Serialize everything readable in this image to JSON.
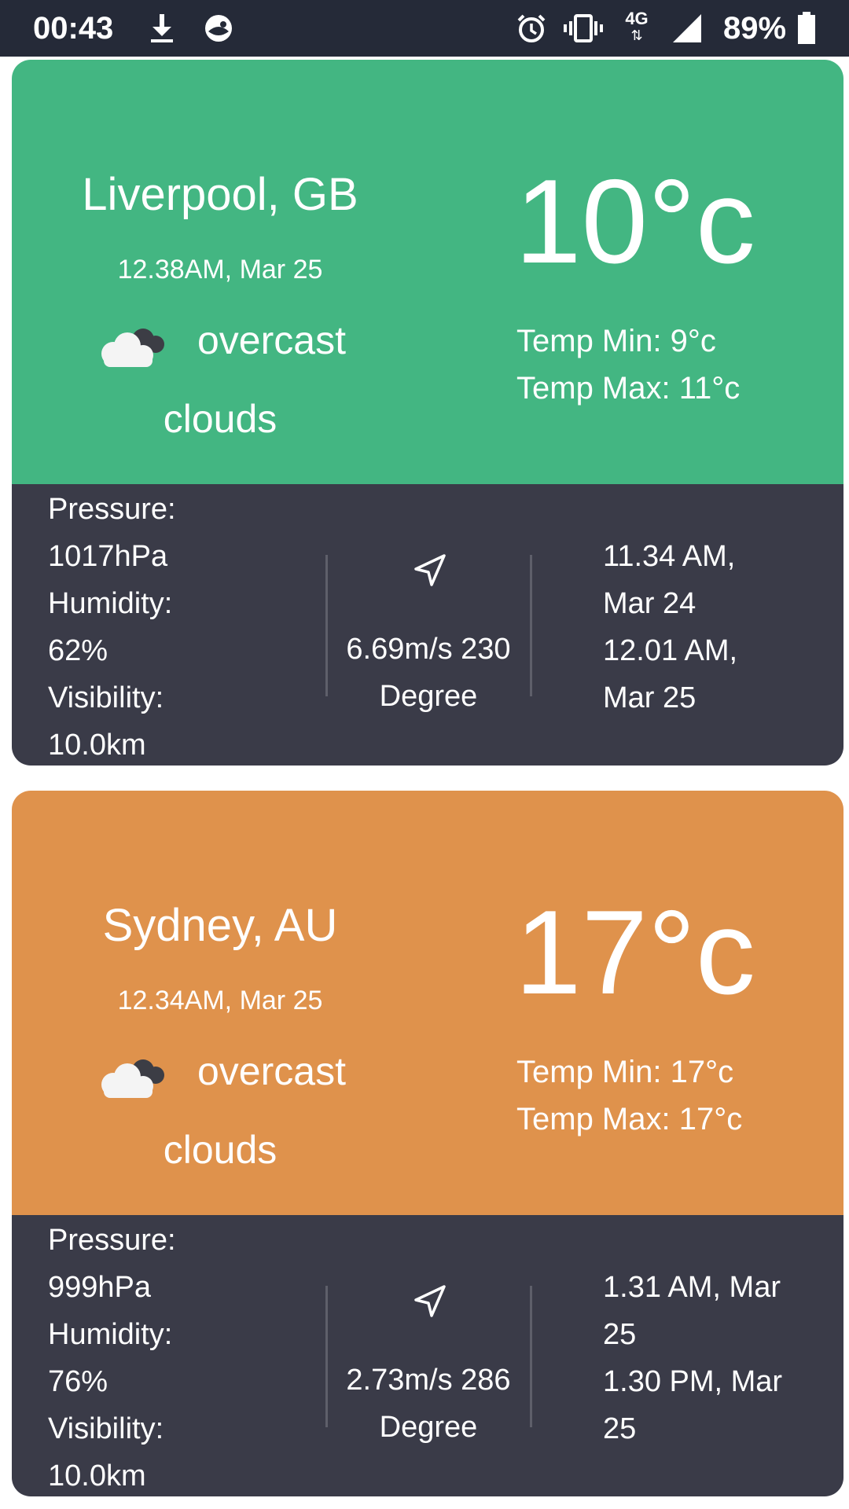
{
  "status_bar": {
    "time": "00:43",
    "battery": "89%",
    "network": "4G"
  },
  "cards": [
    {
      "city": "Liverpool, GB",
      "local_time": "12.38AM, Mar 25",
      "description_line1": "overcast",
      "description_line2": "clouds",
      "temp": "10°c",
      "temp_min": "Temp Min: 9°c",
      "temp_max": "Temp Max: 11°c",
      "pressure_label": "Pressure:",
      "pressure_value": "1017hPa",
      "humidity_label": "Humidity:",
      "humidity_value": "62%",
      "visibility_label": "Visibility:",
      "visibility_value": "10.0km",
      "wind_line1": "6.69m/s 230",
      "wind_line2": "Degree",
      "sunrise_line1": "11.34 AM,",
      "sunrise_line2": "Mar 24",
      "sunset_line1": "12.01 AM,",
      "sunset_line2": "Mar 25",
      "color": "#43b682"
    },
    {
      "city": "Sydney, AU",
      "local_time": "12.34AM, Mar 25",
      "description_line1": "overcast",
      "description_line2": "clouds",
      "temp": "17°c",
      "temp_min": "Temp Min: 17°c",
      "temp_max": "Temp Max: 17°c",
      "pressure_label": "Pressure:",
      "pressure_value": "999hPa",
      "humidity_label": "Humidity:",
      "humidity_value": "76%",
      "visibility_label": "Visibility:",
      "visibility_value": "10.0km",
      "wind_line1": "2.73m/s 286",
      "wind_line2": "Degree",
      "sunrise_line1": "1.31 AM, Mar",
      "sunrise_line2": "25",
      "sunset_line1": "1.30 PM, Mar",
      "sunset_line2": "25",
      "color": "#df924c"
    }
  ],
  "colors": {
    "status_bar": "#252a38",
    "details_panel": "#3a3b48"
  }
}
